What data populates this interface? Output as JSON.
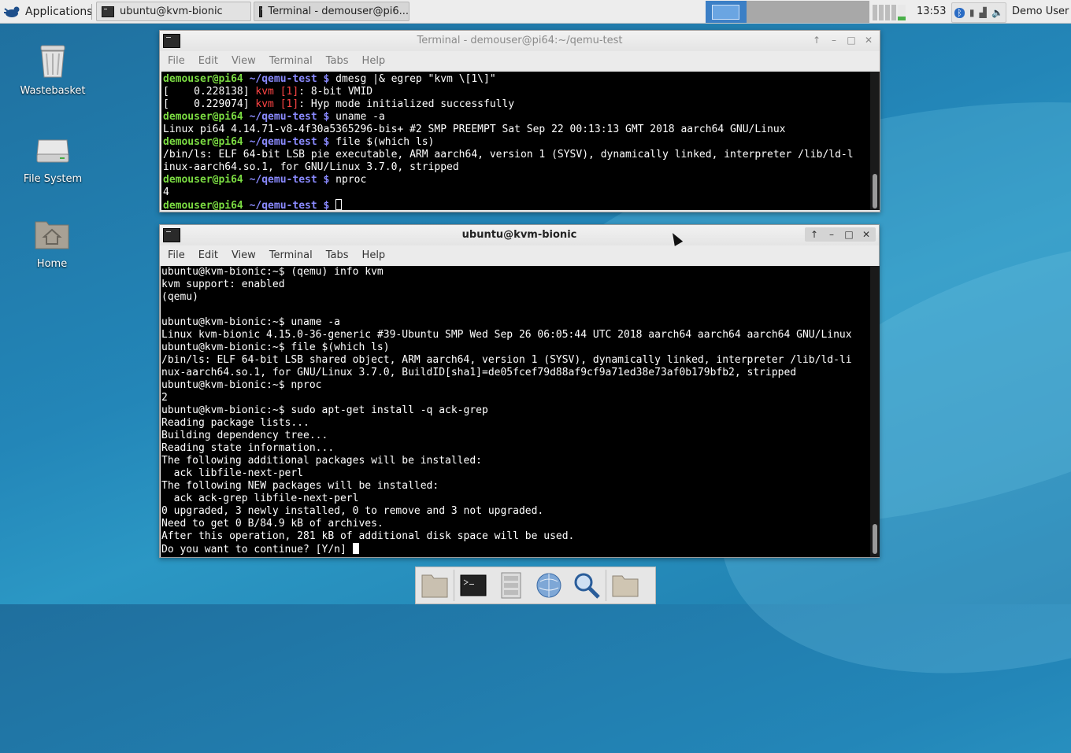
{
  "panel": {
    "applications_label": "Applications",
    "tasks": [
      {
        "label": "ubuntu@kvm-bionic"
      },
      {
        "label": "Terminal - demouser@pi6..."
      }
    ],
    "clock": "13:53",
    "user": "Demo User"
  },
  "desktop": {
    "icons": [
      {
        "label": "Wastebasket"
      },
      {
        "label": "File System"
      },
      {
        "label": "Home"
      }
    ]
  },
  "window1": {
    "title": "Terminal - demouser@pi64:~/qemu-test",
    "menu": [
      "File",
      "Edit",
      "View",
      "Terminal",
      "Tabs",
      "Help"
    ],
    "prompt_user": "demouser@pi64",
    "prompt_path": " ~/qemu-test $ ",
    "lines": {
      "l1_cmd": "dmesg |& egrep \"kvm \\[1\\]\"",
      "l2_pre": "[    0.228138] ",
      "l2_kvm": "kvm [1]",
      "l2_post": ": 8-bit VMID",
      "l3_pre": "[    0.229074] ",
      "l3_kvm": "kvm [1]",
      "l3_post": ": Hyp mode initialized successfully",
      "l4_cmd": "uname -a",
      "l5": "Linux pi64 4.14.71-v8-4f30a5365296-bis+ #2 SMP PREEMPT Sat Sep 22 00:13:13 GMT 2018 aarch64 GNU/Linux",
      "l6_cmd": "file $(which ls)",
      "l7": "/bin/ls: ELF 64-bit LSB pie executable, ARM aarch64, version 1 (SYSV), dynamically linked, interpreter /lib/ld-l",
      "l8": "inux-aarch64.so.1, for GNU/Linux 3.7.0, stripped",
      "l9_cmd": "nproc",
      "l10": "4"
    }
  },
  "window2": {
    "title": "ubuntu@kvm-bionic",
    "menu": [
      "File",
      "Edit",
      "View",
      "Terminal",
      "Tabs",
      "Help"
    ],
    "lines": [
      "ubuntu@kvm-bionic:~$ (qemu) info kvm",
      "kvm support: enabled",
      "(qemu)",
      "",
      "ubuntu@kvm-bionic:~$ uname -a",
      "Linux kvm-bionic 4.15.0-36-generic #39-Ubuntu SMP Wed Sep 26 06:05:44 UTC 2018 aarch64 aarch64 aarch64 GNU/Linux",
      "ubuntu@kvm-bionic:~$ file $(which ls)",
      "/bin/ls: ELF 64-bit LSB shared object, ARM aarch64, version 1 (SYSV), dynamically linked, interpreter /lib/ld-li",
      "nux-aarch64.so.1, for GNU/Linux 3.7.0, BuildID[sha1]=de05fcef79d88af9cf9a71ed38e73af0b179bfb2, stripped",
      "ubuntu@kvm-bionic:~$ nproc",
      "2",
      "ubuntu@kvm-bionic:~$ sudo apt-get install -q ack-grep",
      "Reading package lists...",
      "Building dependency tree...",
      "Reading state information...",
      "The following additional packages will be installed:",
      "  ack libfile-next-perl",
      "The following NEW packages will be installed:",
      "  ack ack-grep libfile-next-perl",
      "0 upgraded, 3 newly installed, 0 to remove and 3 not upgraded.",
      "Need to get 0 B/84.9 kB of archives.",
      "After this operation, 281 kB of additional disk space will be used."
    ],
    "last_line": "Do you want to continue? [Y/n] "
  },
  "colors": {
    "prompt_user": "#7bdc42",
    "prompt_path": "#8a8aff",
    "kvm_highlight": "#ff4444"
  }
}
